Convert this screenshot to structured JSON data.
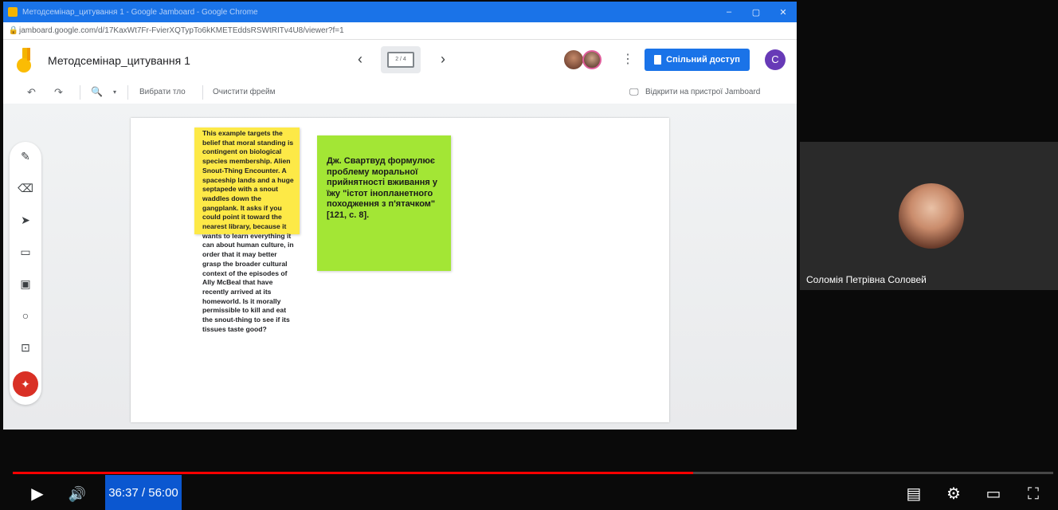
{
  "browser": {
    "window_title": "Методсемінар_цитування 1 - Google Jamboard - Google Chrome",
    "url": "jamboard.google.com/d/17KaxWt7Fr-FvierXQTypTo6kKMETEddsRSWtRITv4U8/viewer?f=1"
  },
  "app": {
    "doc_title": "Методсемінар_цитування 1",
    "frame_indicator": "2 / 4",
    "share_label": "Спільний доступ",
    "account_initial": "C",
    "more_icon": "⋮",
    "prev_icon": "‹",
    "next_icon": "›"
  },
  "toolbar": {
    "undo": "↶",
    "redo": "↷",
    "zoom": "🔍",
    "zoom_caret": "▾",
    "set_background": "Вибрати тло",
    "clear_frame": "Очистити фрейм",
    "open_on_device": "Відкрити на пристрої Jamboard"
  },
  "tools": {
    "pen": "✎",
    "eraser": "⌫",
    "select": "➤",
    "sticky": "▭",
    "image": "▣",
    "shape": "○",
    "textbox": "⊡",
    "laser": "✦"
  },
  "notes": {
    "english": "This example targets the belief that moral standing is contingent on biological species membership. Alien Snout-Thing Encounter. A spaceship lands and a huge septapede with a snout waddles down the gangplank. It asks if you could point it toward the nearest library, because it wants to learn everything it can about human culture, in order that it may better grasp the broader cultural context of the episodes of Ally McBeal that have recently arrived at its homeworld. Is it morally permissible to kill and eat the snout-thing to see if its tissues taste good?",
    "ukrainian": "Дж. Свартвуд формулює проблему моральної прийнятності вживання у їжу \"істот інопланетного походження з п'ятачком\" [121, с. 8]."
  },
  "participant": {
    "name": "Соломія Петрівна Соловей"
  },
  "player": {
    "time": "36:37 / 56:00",
    "progress": 0.654,
    "play_icon": "▶",
    "volume_icon": "🔊",
    "subtitles_icon": "▤",
    "settings_icon": "⚙",
    "miniplayer_icon": "▭",
    "fullscreen_icon": "⛶"
  },
  "colors": {
    "brand_blue": "#1a73e8",
    "sticky_yellow": "#fde947",
    "sticky_green": "#a3e635",
    "progress_red": "#ff0000",
    "laser_red": "#d93025"
  }
}
